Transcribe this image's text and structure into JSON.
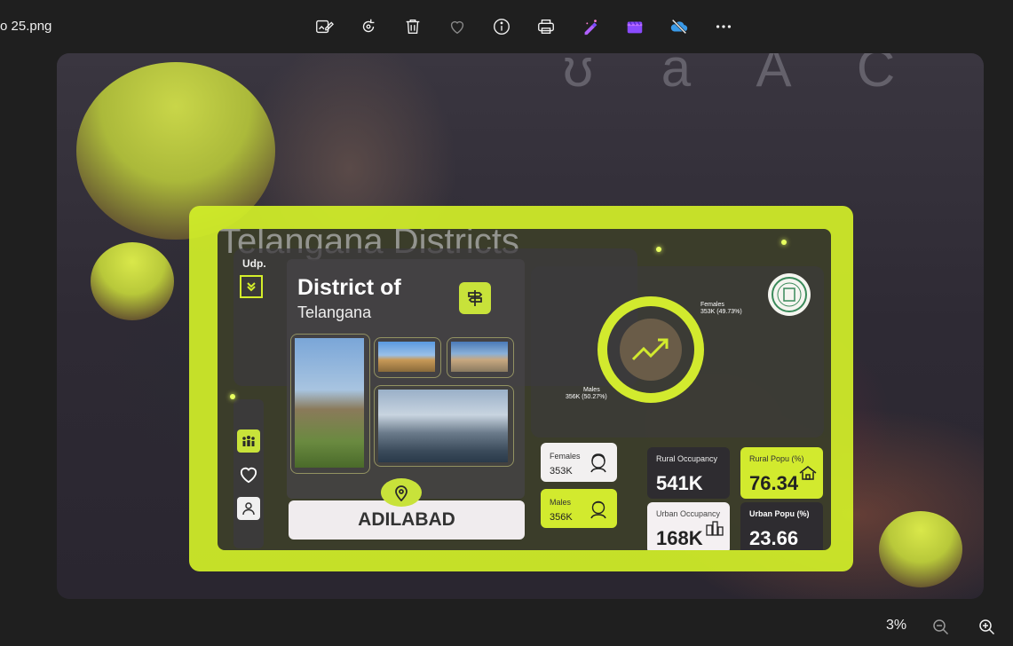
{
  "titlebar": {
    "filename": "o 25.png",
    "toolbar_icons": [
      "edit-image-icon",
      "rotate-icon",
      "delete-icon",
      "favorite-icon",
      "info-icon",
      "print-icon",
      "ai-edit-icon",
      "clipchamp-icon",
      "onedrive-off-icon",
      "more-icon"
    ]
  },
  "image": {
    "dashboard": {
      "background_title": "Telangana Districts",
      "udp_label": "Udp.",
      "district_title": "District of",
      "district_subtitle": "Telangana",
      "selected_district": "ADILABAD",
      "donut": {
        "females_label": "Females",
        "females_value": "353K (49.73%)",
        "males_label": "Males",
        "males_value": "356K (50.27%)"
      },
      "gender_cards": [
        {
          "label": "Females",
          "value": "353K"
        },
        {
          "label": "Males",
          "value": "356K"
        }
      ],
      "kpis": {
        "rural_occupancy": {
          "label": "Rural Occupancy",
          "value": "541K"
        },
        "rural_popu": {
          "label": "Rural Popu (%)",
          "value": "76.34"
        },
        "urban_occupancy": {
          "label": "Urban Occupancy",
          "value": "168K"
        },
        "urban_popu": {
          "label": "Urban Popu (%)",
          "value": "23.66"
        }
      },
      "colors": {
        "accent": "#d2ea2e",
        "panel": "#2a282c"
      }
    }
  },
  "statusbar": {
    "zoom": "3%"
  }
}
